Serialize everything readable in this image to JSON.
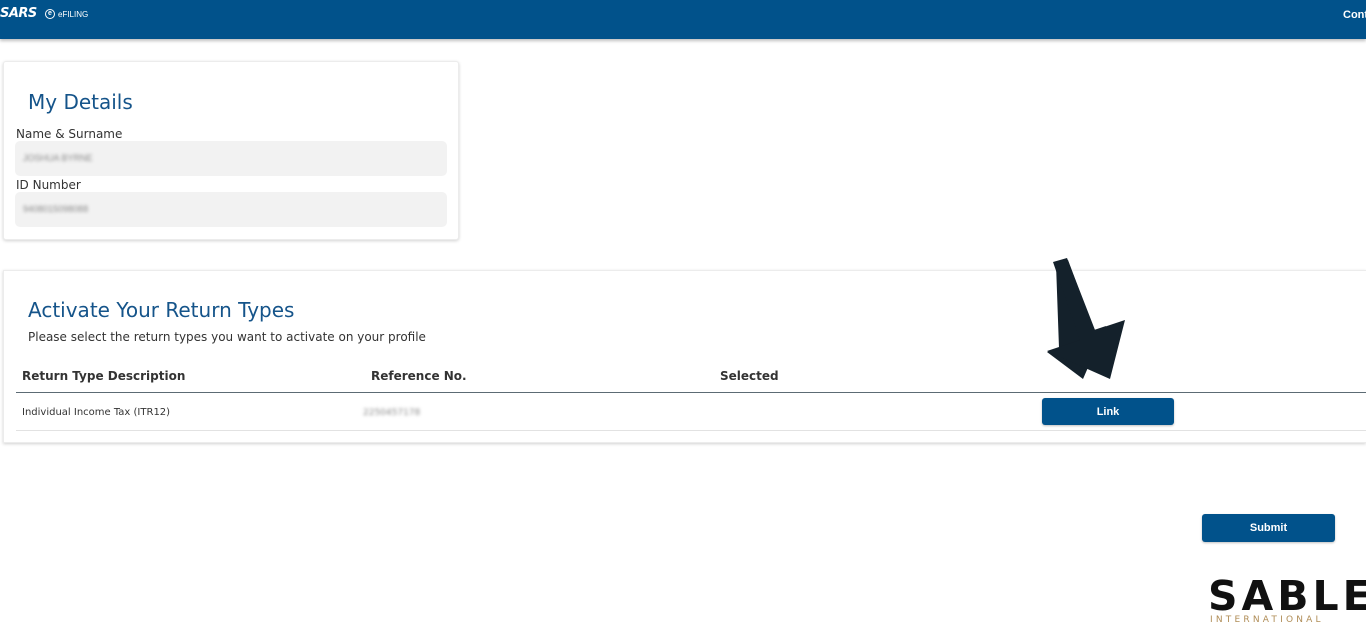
{
  "header": {
    "brand": "SARS",
    "efiling_logo": "eFILING",
    "right_link": "Conta"
  },
  "my_details": {
    "title": "My Details",
    "name_label": "Name & Surname",
    "name_value": "JOSHUA BYRNE",
    "id_label": "ID Number",
    "id_value": "9408015098088"
  },
  "return_types": {
    "title": "Activate Your Return Types",
    "subtitle": "Please select the return types you want to activate on your profile",
    "columns": [
      "Return Type Description",
      "Reference No.",
      "Selected"
    ],
    "rows": [
      {
        "description": "Individual Income Tax (ITR12)",
        "reference": "2250457178",
        "action_label": "Link"
      }
    ]
  },
  "submit_label": "Submit",
  "annotation": {
    "icon": "down-right-arrow-icon",
    "color": "#14212b"
  },
  "watermark": {
    "word": "SABLE",
    "sub": "INTERNATIONAL",
    "sub_color": "#b08d57"
  },
  "colors": {
    "primary": "#01528b",
    "title": "#15548a"
  }
}
